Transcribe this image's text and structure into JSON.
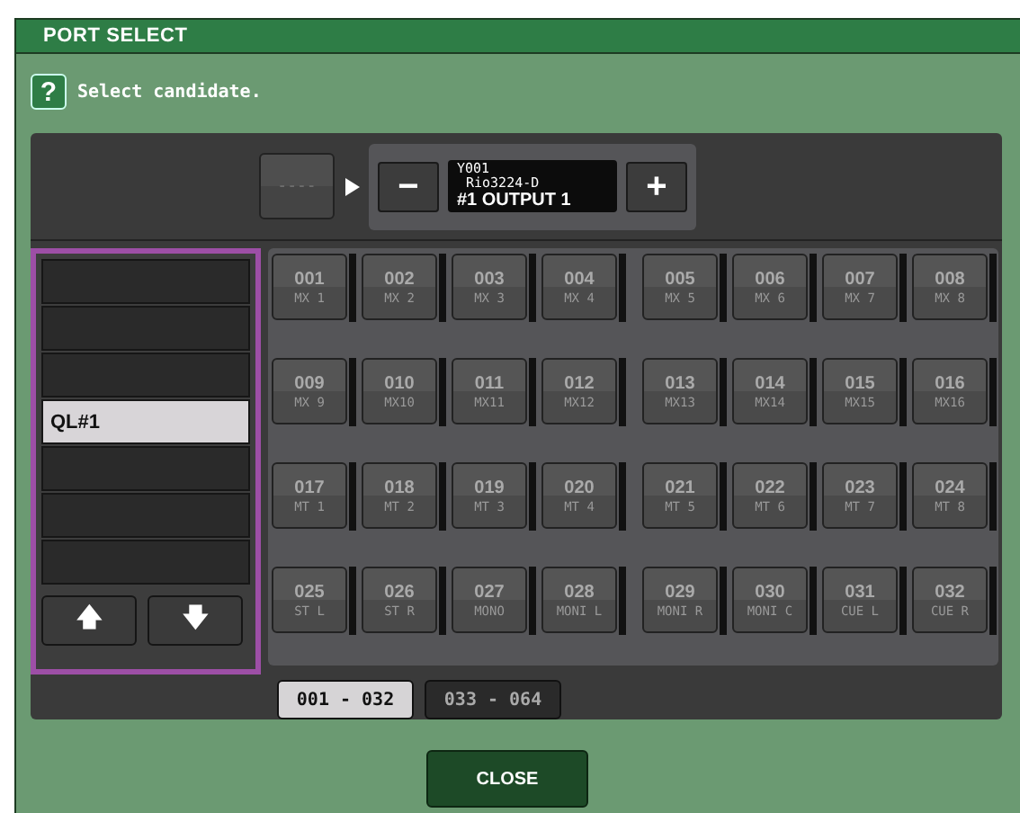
{
  "window": {
    "title": "PORT SELECT"
  },
  "prompt": {
    "help": "?",
    "text": "Select candidate."
  },
  "selector": {
    "current": "----",
    "line_1": "Y001",
    "line_2": "Rio3224-D",
    "line_3": "#1 OUTPUT 1",
    "minus": "−",
    "plus": "+"
  },
  "list": {
    "items": [
      {
        "selected": false
      },
      {
        "selected": false
      },
      {
        "selected": false
      },
      {
        "label": "QL#1",
        "selected": true
      },
      {
        "selected": false
      },
      {
        "selected": false
      },
      {
        "selected": false
      }
    ],
    "up": "🡅",
    "down": "🡇"
  },
  "ports": [
    {
      "number": "001",
      "name": "MX 1"
    },
    {
      "number": "002",
      "name": "MX 2"
    },
    {
      "number": "003",
      "name": "MX 3"
    },
    {
      "number": "004",
      "name": "MX 4"
    },
    {
      "number": "005",
      "name": "MX 5"
    },
    {
      "number": "006",
      "name": "MX 6"
    },
    {
      "number": "007",
      "name": "MX 7"
    },
    {
      "number": "008",
      "name": "MX 8"
    },
    {
      "number": "009",
      "name": "MX 9"
    },
    {
      "number": "010",
      "name": "MX10"
    },
    {
      "number": "011",
      "name": "MX11"
    },
    {
      "number": "012",
      "name": "MX12"
    },
    {
      "number": "013",
      "name": "MX13"
    },
    {
      "number": "014",
      "name": "MX14"
    },
    {
      "number": "015",
      "name": "MX15"
    },
    {
      "number": "016",
      "name": "MX16"
    },
    {
      "number": "017",
      "name": "MT 1"
    },
    {
      "number": "018",
      "name": "MT 2"
    },
    {
      "number": "019",
      "name": "MT 3"
    },
    {
      "number": "020",
      "name": "MT 4"
    },
    {
      "number": "021",
      "name": "MT 5"
    },
    {
      "number": "022",
      "name": "MT 6"
    },
    {
      "number": "023",
      "name": "MT 7"
    },
    {
      "number": "024",
      "name": "MT 8"
    },
    {
      "number": "025",
      "name": "ST L"
    },
    {
      "number": "026",
      "name": "ST R"
    },
    {
      "number": "027",
      "name": "MONO"
    },
    {
      "number": "028",
      "name": "MONI L"
    },
    {
      "number": "029",
      "name": "MONI R"
    },
    {
      "number": "030",
      "name": "MONI C"
    },
    {
      "number": "031",
      "name": "CUE L"
    },
    {
      "number": "032",
      "name": "CUE R"
    }
  ],
  "banks": [
    {
      "label": "001 - 032",
      "selected": true
    },
    {
      "label": "033 - 064",
      "selected": false
    }
  ],
  "close": "CLOSE"
}
